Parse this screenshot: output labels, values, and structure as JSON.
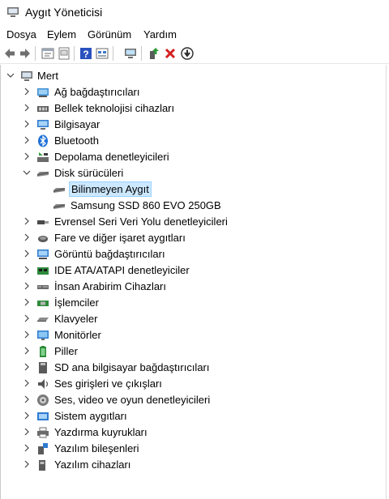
{
  "window": {
    "title": "Aygıt Yöneticisi",
    "icon": "device-manager-icon"
  },
  "menu": [
    "Dosya",
    "Eylem",
    "Görünüm",
    "Yardım"
  ],
  "toolbar": [
    "back-arrow-icon",
    "forward-arrow-icon",
    "properties-icon",
    "update-driver-icon",
    "help-icon",
    "show-hidden-icon",
    "scan-hardware-icon",
    "enable-device-icon",
    "uninstall-icon",
    "disable-device-icon"
  ],
  "tree": {
    "root": {
      "label": "Mert",
      "icon": "computer-icon",
      "expanded": true
    },
    "categories": [
      {
        "label": "Ağ bağdaştırıcıları",
        "icon": "network-adapter-icon",
        "expanded": false
      },
      {
        "label": "Bellek teknolojisi cihazları",
        "icon": "memory-device-icon",
        "expanded": false
      },
      {
        "label": "Bilgisayar",
        "icon": "computer-icon",
        "expanded": false
      },
      {
        "label": "Bluetooth",
        "icon": "bluetooth-icon",
        "expanded": false
      },
      {
        "label": "Depolama denetleyicileri",
        "icon": "storage-controller-icon",
        "expanded": false
      },
      {
        "label": "Disk sürücüleri",
        "icon": "disk-drive-icon",
        "expanded": true,
        "children": [
          {
            "label": "Bilinmeyen Aygıt",
            "icon": "disk-drive-icon",
            "selected": true
          },
          {
            "label": "Samsung SSD 860 EVO 250GB",
            "icon": "disk-drive-icon",
            "selected": false
          }
        ]
      },
      {
        "label": "Evrensel Seri Veri Yolu denetleyicileri",
        "icon": "usb-icon",
        "expanded": false
      },
      {
        "label": "Fare ve diğer işaret aygıtları",
        "icon": "mouse-icon",
        "expanded": false
      },
      {
        "label": "Görüntü bağdaştırıcıları",
        "icon": "display-adapter-icon",
        "expanded": false
      },
      {
        "label": "IDE ATA/ATAPI denetleyiciler",
        "icon": "ide-controller-icon",
        "expanded": false
      },
      {
        "label": "İnsan Arabirim Cihazları",
        "icon": "hid-icon",
        "expanded": false
      },
      {
        "label": "İşlemciler",
        "icon": "processor-icon",
        "expanded": false
      },
      {
        "label": "Klavyeler",
        "icon": "keyboard-icon",
        "expanded": false
      },
      {
        "label": "Monitörler",
        "icon": "monitor-icon",
        "expanded": false
      },
      {
        "label": "Piller",
        "icon": "battery-icon",
        "expanded": false
      },
      {
        "label": "SD ana bilgisayar bağdaştırıcıları",
        "icon": "sd-host-icon",
        "expanded": false
      },
      {
        "label": "Ses girişleri ve çıkışları",
        "icon": "audio-io-icon",
        "expanded": false
      },
      {
        "label": "Ses, video ve oyun denetleyicileri",
        "icon": "sound-controller-icon",
        "expanded": false
      },
      {
        "label": "Sistem aygıtları",
        "icon": "system-device-icon",
        "expanded": false
      },
      {
        "label": "Yazdırma kuyrukları",
        "icon": "print-queue-icon",
        "expanded": false
      },
      {
        "label": "Yazılım bileşenleri",
        "icon": "software-component-icon",
        "expanded": false
      },
      {
        "label": "Yazılım cihazları",
        "icon": "software-device-icon",
        "expanded": false
      }
    ]
  },
  "colors": {
    "selection_bg": "#cce8ff",
    "selection_border": "#99d1ff",
    "accent": "#0078d7"
  }
}
